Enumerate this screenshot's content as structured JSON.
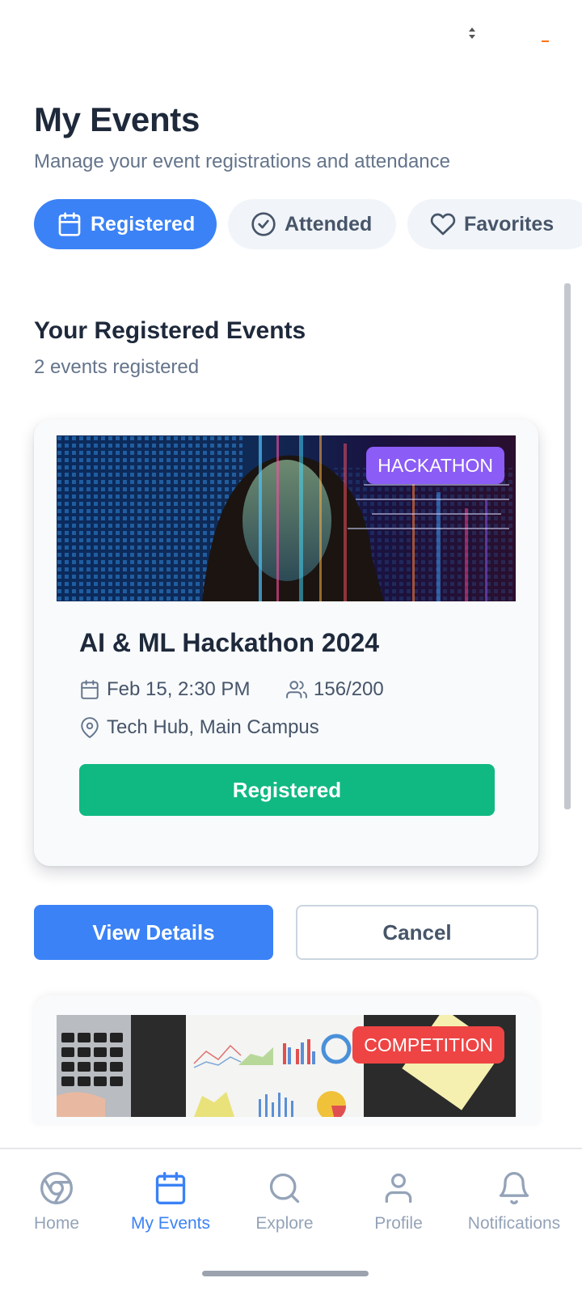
{
  "header": {
    "title": "My Events",
    "subtitle": "Manage your event registrations and attendance"
  },
  "tabs": [
    {
      "label": "Registered",
      "icon": "calendar-icon",
      "active": true
    },
    {
      "label": "Attended",
      "icon": "check-circle-icon",
      "active": false
    },
    {
      "label": "Favorites",
      "icon": "heart-icon",
      "active": false
    }
  ],
  "section": {
    "title": "Your Registered Events",
    "count": "2 events registered"
  },
  "events": [
    {
      "badge": "HACKATHON",
      "title": "AI & ML Hackathon 2024",
      "date": "Feb 15, 2:30 PM",
      "attendance": "156/200",
      "location": "Tech Hub, Main Campus",
      "status_button": "Registered"
    },
    {
      "badge": "COMPETITION"
    }
  ],
  "actions": {
    "view": "View Details",
    "cancel": "Cancel"
  },
  "nav": [
    {
      "label": "Home",
      "icon": "chrome-icon"
    },
    {
      "label": "My Events",
      "icon": "calendar-icon",
      "active": true
    },
    {
      "label": "Explore",
      "icon": "search-icon"
    },
    {
      "label": "Profile",
      "icon": "user-icon"
    },
    {
      "label": "Notifications",
      "icon": "bell-icon"
    }
  ],
  "colors": {
    "primary": "#3b82f6",
    "success": "#10b981",
    "hackathon_badge": "#8b5cf6",
    "competition_badge": "#ef4444"
  }
}
